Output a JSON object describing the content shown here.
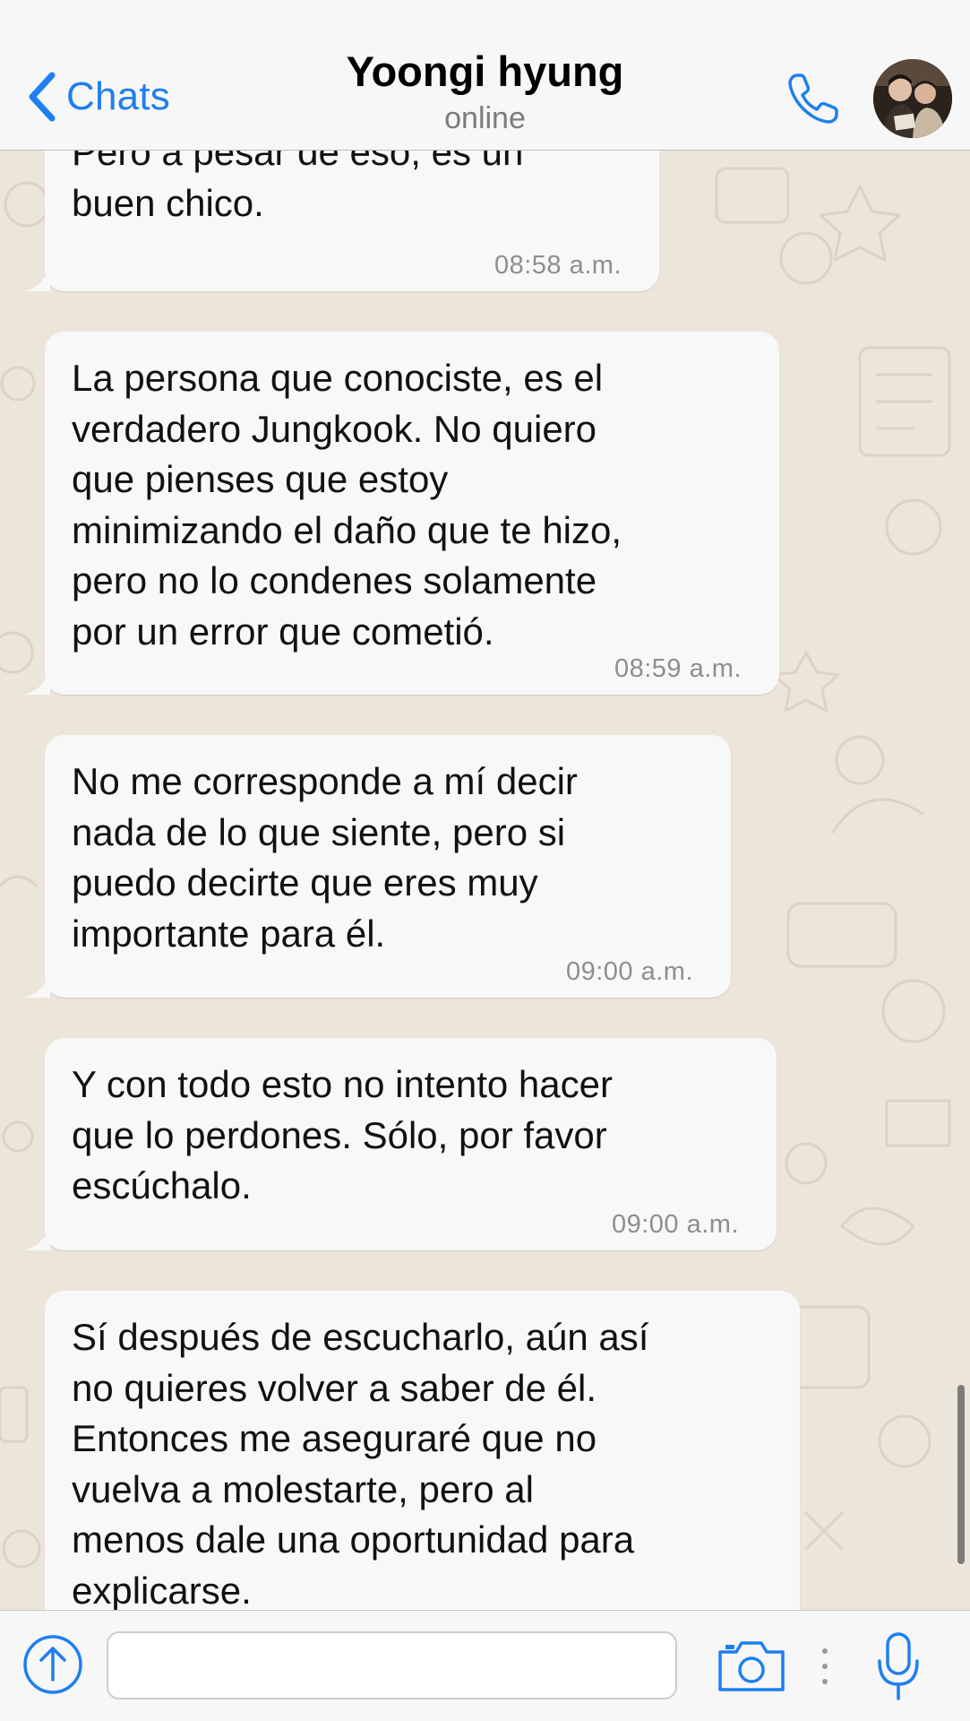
{
  "header": {
    "back_label": "Chats",
    "contact_name": "Yoongi hyung",
    "status": "online"
  },
  "messages": [
    {
      "text": "Pero a pesar de eso, es un\nbuen chico.",
      "time": "08:58 a.m."
    },
    {
      "text": "La persona que conociste, es el\nverdadero Jungkook. No quiero\nque pienses que estoy\nminimizando el daño que te hizo,\npero no lo condenes solamente\npor un error que cometió.",
      "time": "08:59 a.m."
    },
    {
      "text": "No me corresponde a mí decir\nnada de lo que siente, pero si\npuedo decirte que eres muy\nimportante para él.",
      "time": "09:00 a.m."
    },
    {
      "text": "Y con todo esto no intento hacer\nque lo perdones. Sólo, por favor\nescúchalo.",
      "time": "09:00 a.m."
    },
    {
      "text": "Sí después de escucharlo, aún así\nno quieres volver a saber de él.\nEntonces me aseguraré que no\nvuelva a molestarte, pero al\nmenos dale una oportunidad para\nexplicarse.",
      "time": ""
    }
  ],
  "input": {
    "value": "",
    "placeholder": ""
  },
  "colors": {
    "accent": "#1e7ff0",
    "bubble": "#f8f8f8",
    "wallpaper": "#ece5da",
    "bar": "#f7f7f7"
  },
  "icons": {
    "back": "chevron-left-icon",
    "call": "phone-icon",
    "attach": "arrow-up-circle-icon",
    "camera": "camera-icon",
    "more": "vertical-dots-icon",
    "mic": "microphone-icon"
  }
}
